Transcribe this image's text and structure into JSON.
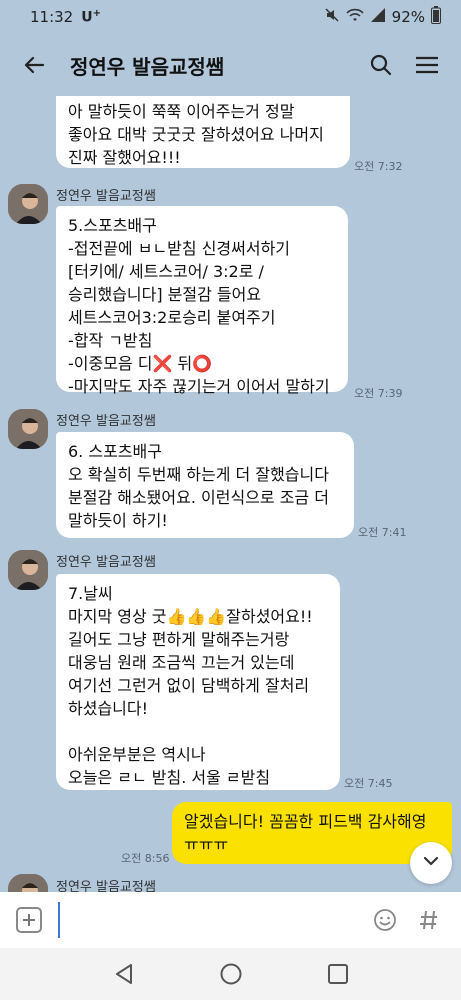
{
  "status": {
    "time": "11:32",
    "carrier": "U",
    "carrier_sup": "+",
    "battery": "92%"
  },
  "header": {
    "title": "정연우 발음교정쌤"
  },
  "messages": [
    {
      "text": "아 말하듯이 쭉쭉 이어주는거 정말\n좋아요 대박 굿굿굿 잘하셨어요 나머지\n진짜 잘했어요!!!",
      "time": "오전 7:32"
    },
    {
      "sender": "정연우 발음교정쌤",
      "text": "5.스포츠배구\n-접전끝에 ㅂㄴ받침 신경써서하기\n[터키에/ 세트스코어/ 3:2로 /\n승리했습니다] 분절감 들어요\n세트스코어3:2로승리 붙여주기\n-합작 ㄱ받침\n-이중모음 디❌ 뒤⭕\n-마지막도 자주 끊기는거 이어서 말하기",
      "time": "오전 7:39"
    },
    {
      "sender": "정연우 발음교정쌤",
      "text": "6. 스포츠배구\n오 확실히 두번째 하는게 더 잘했습니다\n분절감 해소됐어요. 이런식으로 조금 더\n말하듯이 하기!",
      "time": "오전 7:41"
    },
    {
      "sender": "정연우 발음교정쌤",
      "text": "7.날씨\n마지막 영상 굿👍👍👍잘하셨어요!!\n길어도 그냥 편하게 말해주는거랑\n대웅님 원래 조금씩 끄는거 있는데\n여기선 그런거 없이 담백하게 잘처리\n하셨습니다!\n\n아쉬운부분은 역시나\n오늘은 ㄹㄴ 받침. 서울 ㄹ받침",
      "time": "오전 7:45"
    },
    {
      "text": "알겠습니다!  꼼꼼한 피드백 감사해영\nㅠㅠㅠ",
      "time": "오전 8:56"
    },
    {
      "sender": "정연우 발음교정쌤"
    }
  ],
  "icons": {
    "back": "back-arrow-icon",
    "search": "search-icon",
    "menu": "hamburger-menu-icon",
    "scroll": "chevron-down-icon",
    "plus": "plus-icon",
    "emoji": "emoji-icon",
    "hash": "hash-icon"
  },
  "input": {
    "placeholder": ""
  },
  "colors": {
    "chat_bg": "#b2c7da",
    "my_bubble": "#fae100",
    "their_bubble": "#ffffff"
  }
}
